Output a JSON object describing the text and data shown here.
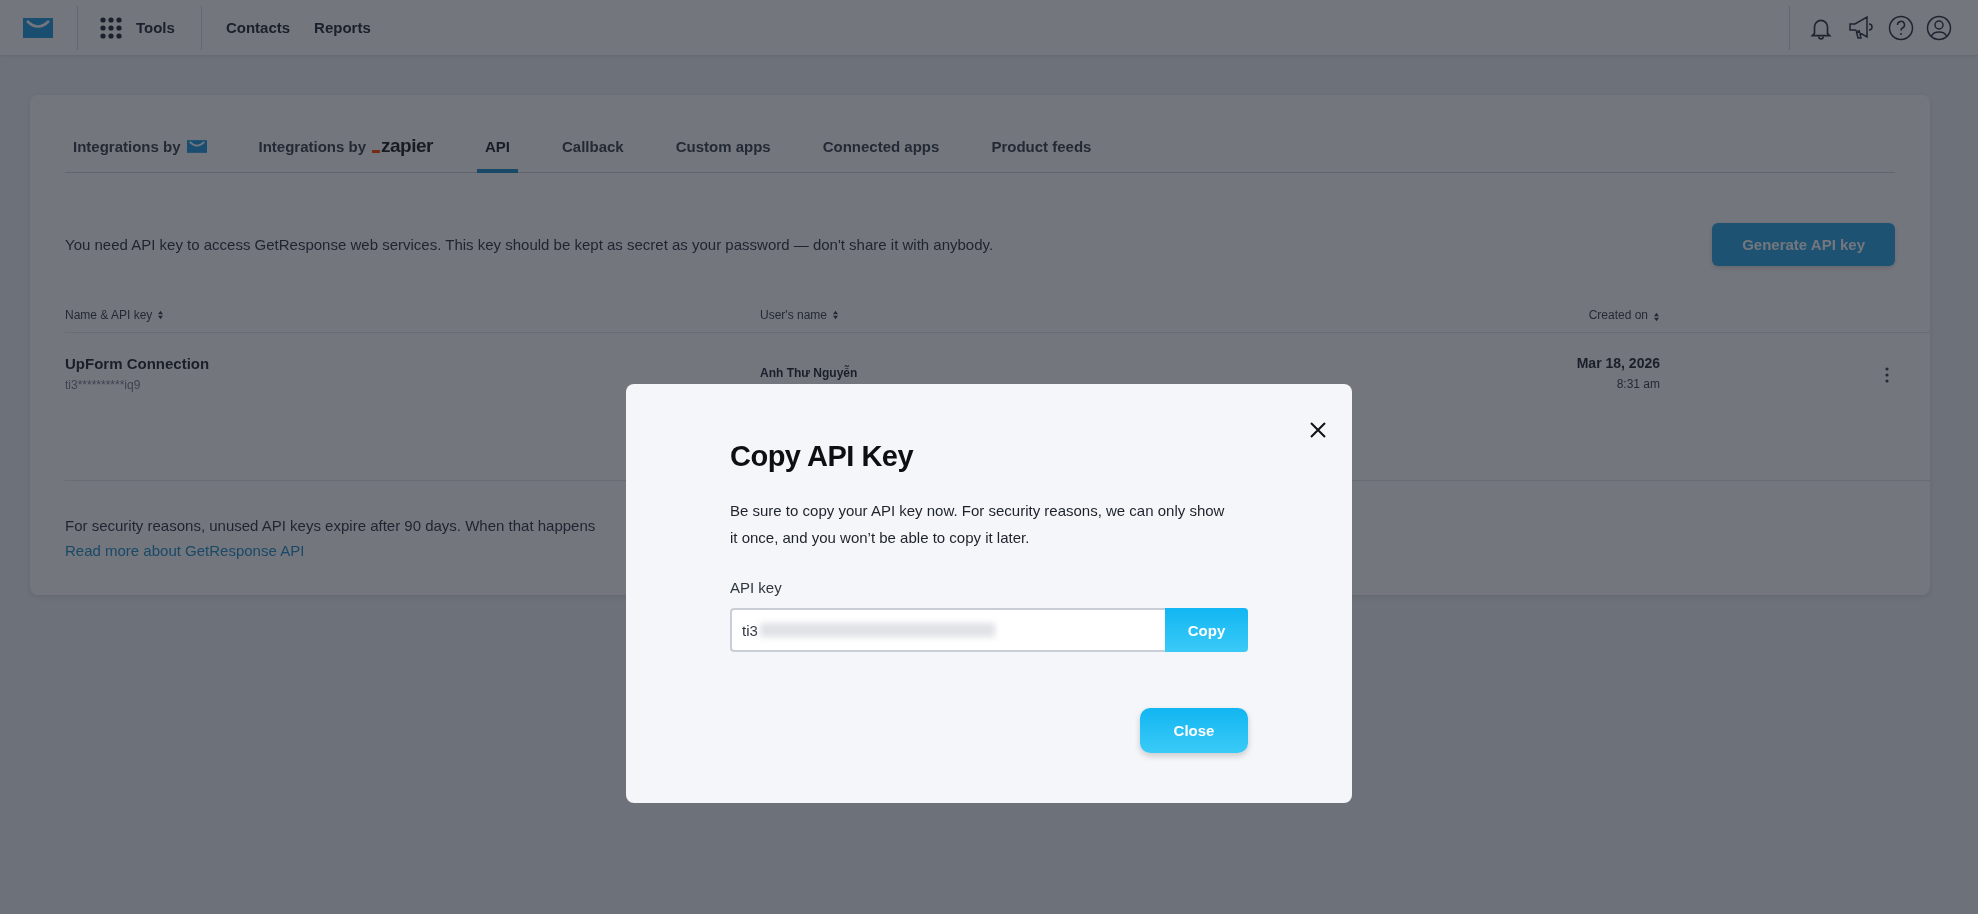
{
  "top_bar": {
    "tools_label": "Tools",
    "nav": [
      "Contacts",
      "Reports"
    ]
  },
  "tabs": [
    {
      "label": "Integrations by",
      "kind": "mail_logo",
      "selected": false
    },
    {
      "label": "Integrations by",
      "kind": "zapier_logo",
      "logo_text": "zapier",
      "selected": false
    },
    {
      "label": "API",
      "selected": true
    },
    {
      "label": "Callback",
      "selected": false
    },
    {
      "label": "Custom apps",
      "selected": false
    },
    {
      "label": "Connected apps",
      "selected": false
    },
    {
      "label": "Product feeds",
      "selected": false
    }
  ],
  "intro": "You need API key to access GetResponse web services. This key should be kept as secret as your password — don't share it with anybody.",
  "generate_button": "Generate API key",
  "table": {
    "columns": [
      "Name & API key",
      "User's name",
      "Created on"
    ],
    "rows": [
      {
        "name": "UpForm Connection",
        "key": "ti3**********iq9",
        "user": "Anh Thư Nguyễn",
        "date": "Mar 18, 2026",
        "time": "8:31 am"
      }
    ]
  },
  "footer": {
    "note": "For security reasons, unused API keys expire after 90 days. When that happens",
    "link": "Read more about GetResponse API"
  },
  "dialog": {
    "title": "Copy API Key",
    "message": "Be sure to copy your API key now. For security reasons, we can only show it once, and you won’t be able to copy it later.",
    "field_label": "API key",
    "field_value": "ti3",
    "copy_button": "Copy",
    "close_button": "Close"
  }
}
